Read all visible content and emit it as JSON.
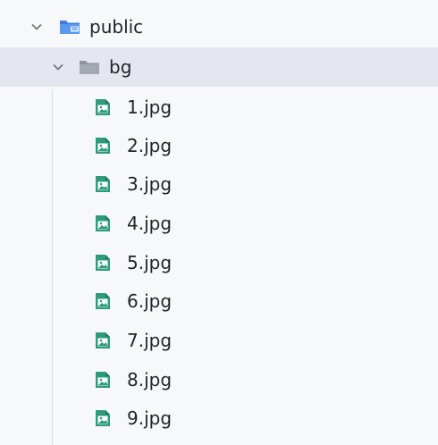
{
  "tree": {
    "root": {
      "label": "public",
      "expanded": true,
      "icon": "folder-open-icon",
      "accent": "#3d7ee0"
    },
    "bg": {
      "label": "bg",
      "expanded": true,
      "selected": true,
      "icon": "folder-icon",
      "accent": "#8d939c"
    },
    "files": [
      {
        "label": "1.jpg",
        "icon": "image-file-icon"
      },
      {
        "label": "2.jpg",
        "icon": "image-file-icon"
      },
      {
        "label": "3.jpg",
        "icon": "image-file-icon"
      },
      {
        "label": "4.jpg",
        "icon": "image-file-icon"
      },
      {
        "label": "5.jpg",
        "icon": "image-file-icon"
      },
      {
        "label": "6.jpg",
        "icon": "image-file-icon"
      },
      {
        "label": "7.jpg",
        "icon": "image-file-icon"
      },
      {
        "label": "8.jpg",
        "icon": "image-file-icon"
      },
      {
        "label": "9.jpg",
        "icon": "image-file-icon"
      }
    ],
    "colors": {
      "selection": "#e4e7ef",
      "file_icon": "#2e9c7a",
      "text": "#22252b"
    }
  }
}
